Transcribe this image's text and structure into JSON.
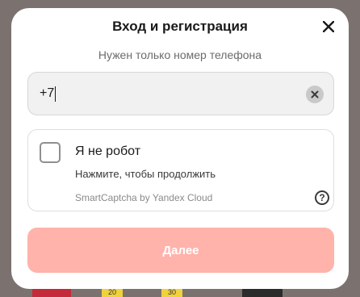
{
  "dialog": {
    "title": "Вход и регистрация",
    "subtitle": "Нужен только номер телефона",
    "close_icon": "close-icon"
  },
  "phone": {
    "value": "+7",
    "clear_icon": "clear-icon"
  },
  "captcha": {
    "title": "Я не робот",
    "subtitle": "Нажмите, чтобы продолжить",
    "brand": "SmartCaptcha by Yandex Cloud",
    "help": "?"
  },
  "submit": {
    "label": "Далее",
    "color": "#ffb3ab"
  },
  "background": {
    "tag_1": "20",
    "tag_2": "30"
  }
}
